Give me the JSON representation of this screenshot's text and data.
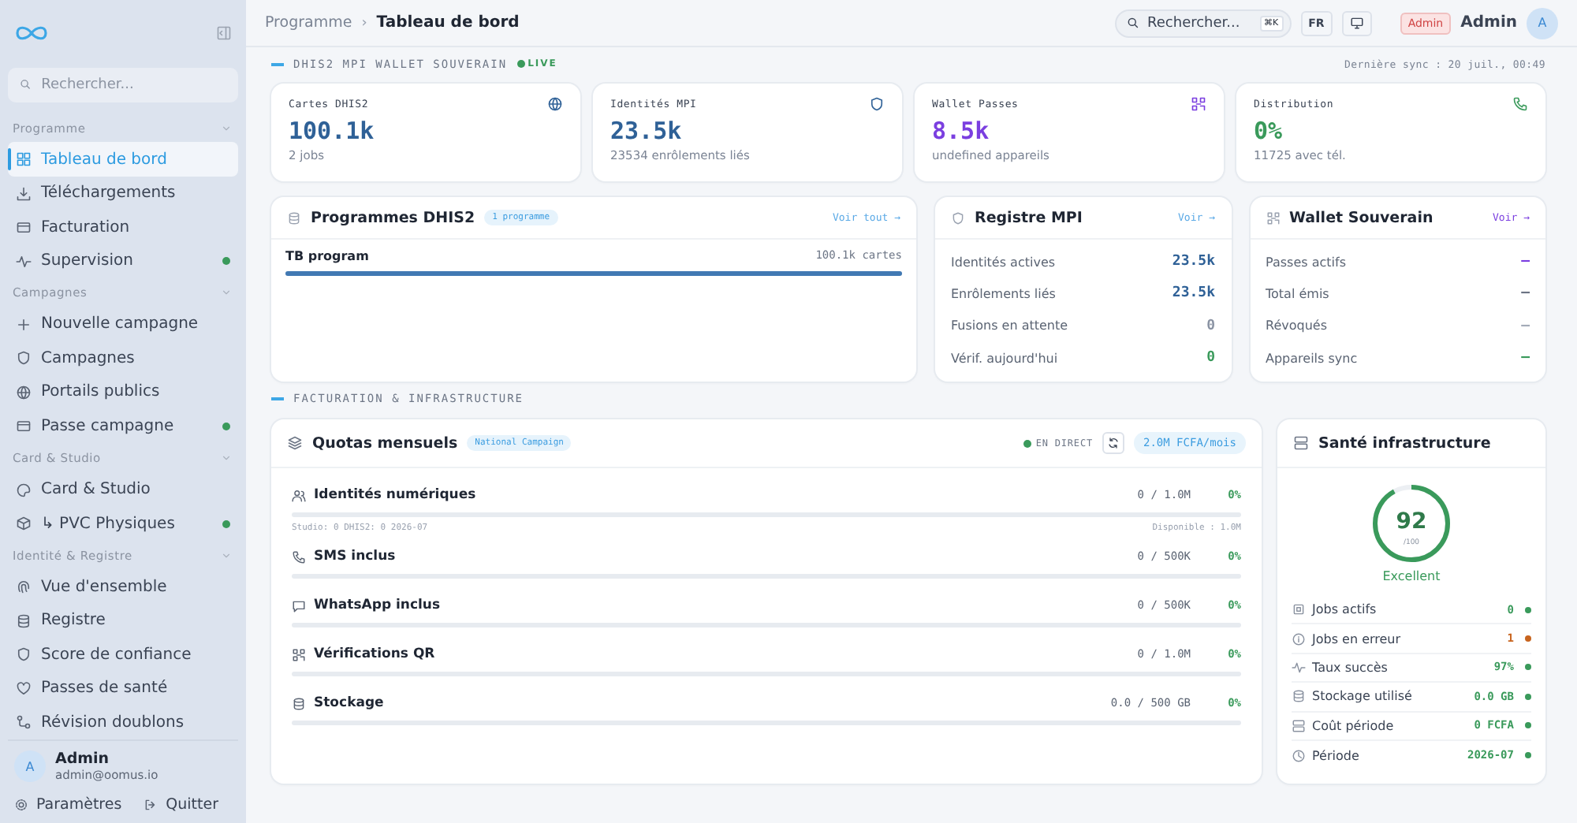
{
  "sidebar": {
    "search": {
      "placeholder": "Rechercher..."
    },
    "groups": [
      {
        "title": "Programme",
        "items": [
          {
            "label": "Tableau de bord",
            "selected": true,
            "dot": false
          },
          {
            "label": "Téléchargements",
            "selected": false,
            "dot": false
          },
          {
            "label": "Facturation",
            "selected": false,
            "dot": false
          },
          {
            "label": "Supervision",
            "selected": false,
            "dot": true
          }
        ]
      },
      {
        "title": "Campagnes",
        "items": [
          {
            "label": "Nouvelle campagne",
            "selected": false,
            "dot": false
          },
          {
            "label": "Campagnes",
            "selected": false,
            "dot": false
          },
          {
            "label": "Portails publics",
            "selected": false,
            "dot": false
          },
          {
            "label": "Passe campagne",
            "selected": false,
            "dot": true
          }
        ]
      },
      {
        "title": "Card & Studio",
        "items": [
          {
            "label": "Card & Studio",
            "selected": false,
            "dot": false
          },
          {
            "label": "↳ PVC Physiques",
            "selected": false,
            "dot": true
          }
        ]
      },
      {
        "title": "Identité & Registre",
        "items": [
          {
            "label": "Vue d'ensemble",
            "selected": false,
            "dot": false
          },
          {
            "label": "Registre",
            "selected": false,
            "dot": false
          },
          {
            "label": "Score de confiance",
            "selected": false,
            "dot": false
          },
          {
            "label": "Passes de santé",
            "selected": false,
            "dot": false
          },
          {
            "label": "Révision doublons",
            "selected": false,
            "dot": false
          }
        ]
      }
    ],
    "user": {
      "avatar": "A",
      "name": "Admin",
      "email": "admin@oomus.io"
    },
    "footer": [
      "Paramètres",
      "Quitter"
    ]
  },
  "topbar": {
    "breadcrumb": [
      "Programme",
      "Tableau de bord"
    ],
    "separator": "›",
    "search": {
      "placeholder": "Rechercher...",
      "shortcut": "⌘K"
    },
    "language": "FR",
    "role": "Admin",
    "user": "Admin",
    "avatar": "A"
  },
  "section_1": {
    "title": "DHIS2 MPI WALLET SOUVERAIN",
    "live": "LIVE",
    "sync": "Dernière sync : 20 juil., 00:49"
  },
  "kpis": [
    {
      "label": "Cartes DHIS2",
      "value": "100.1k",
      "sub": "2 jobs",
      "color": "#2f6197"
    },
    {
      "label": "Identités MPI",
      "value": "23.5k",
      "sub": "23534 enrôlements liés",
      "color": "#2f6197"
    },
    {
      "label": "Wallet Passes",
      "value": "8.5k",
      "sub": "undefined appareils",
      "color": "#7b3fe0"
    },
    {
      "label": "Distribution",
      "value": "0%",
      "sub": "11725 avec tél.",
      "color": "#3a9a5b"
    }
  ],
  "programmes": {
    "title": "Programmes DHIS2",
    "badge": "1 programme",
    "link": "Voir tout →",
    "rows": [
      {
        "name": "TB program",
        "value": "100.1k cartes",
        "level": 1
      }
    ]
  },
  "registre": {
    "title": "Registre MPI",
    "link": "Voir →",
    "rows": [
      {
        "label": "Identités actives",
        "value": "23.5k",
        "color": "#2f6197"
      },
      {
        "label": "Enrôlements liés",
        "value": "23.5k",
        "color": "#2f6197"
      },
      {
        "label": "Fusions en attente",
        "value": "0",
        "color": "#8a93a3"
      },
      {
        "label": "Vérif. aujourd'hui",
        "value": "0",
        "color": "#3a9a5b"
      }
    ]
  },
  "wallet": {
    "title": "Wallet Souverain",
    "link": "Voir →",
    "rows": [
      {
        "label": "Passes actifs",
        "value": "—",
        "color": "#7b3fe0"
      },
      {
        "label": "Total émis",
        "value": "—",
        "color": "#6b7383"
      },
      {
        "label": "Révoqués",
        "value": "—",
        "color": "#a4abb8"
      },
      {
        "label": "Appareils sync",
        "value": "—",
        "color": "#3a9a5b"
      }
    ]
  },
  "section_2": {
    "title": "FACTURATION & INFRASTRUCTURE"
  },
  "quotas": {
    "title": "Quotas mensuels",
    "badge": "National Campaign",
    "live": "EN DIRECT",
    "price": "2.0M FCFA/mois",
    "rows": [
      {
        "label": "Identités numériques",
        "usage": "0 / 1.0M",
        "percent": "0%",
        "level": 0,
        "note_left": "Studio: 0 DHIS2: 0 2026-07",
        "note_right": "Disponible : 1.0M"
      },
      {
        "label": "SMS inclus",
        "usage": "0 / 500K",
        "percent": "0%",
        "level": 0
      },
      {
        "label": "WhatsApp inclus",
        "usage": "0 / 500K",
        "percent": "0%",
        "level": 0
      },
      {
        "label": "Vérifications QR",
        "usage": "0 / 1.0M",
        "percent": "0%",
        "level": 0
      },
      {
        "label": "Stockage",
        "usage": "0.0 / 500 GB",
        "percent": "0%",
        "level": 0
      }
    ]
  },
  "health": {
    "title": "Santé infrastructure",
    "score": "92",
    "scale": "/100",
    "level": 0.92,
    "rating": "Excellent",
    "rows": [
      {
        "label": "Jobs actifs",
        "value": "0",
        "color": "#3a9a5b"
      },
      {
        "label": "Jobs en erreur",
        "value": "1",
        "color": "#c8641e"
      },
      {
        "label": "Taux succès",
        "value": "97%",
        "color": "#3a9a5b"
      },
      {
        "label": "Stockage utilisé",
        "value": "0.0 GB",
        "color": "#3a9a5b"
      },
      {
        "label": "Coût période",
        "value": "0 FCFA",
        "color": "#3a9a5b"
      },
      {
        "label": "Période",
        "value": "2026-07",
        "color": "#3a9a5b"
      }
    ]
  }
}
